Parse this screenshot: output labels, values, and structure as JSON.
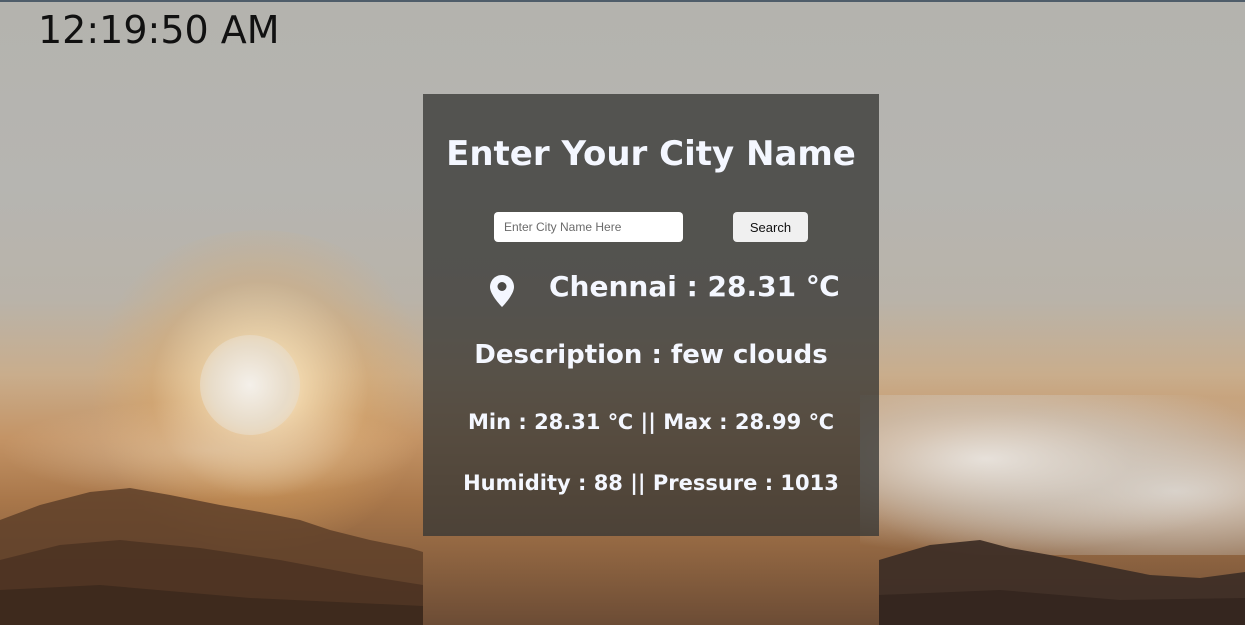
{
  "clock": {
    "time": "12:19:50 AM"
  },
  "card": {
    "title": "Enter Your City Name",
    "search": {
      "placeholder": "Enter City Name Here",
      "value": "",
      "button_label": "Search"
    },
    "location_icon": "map-pin-icon",
    "city_temp": "Chennai : 28.31 ℃",
    "description": "Description : few clouds",
    "min_max": "Min : 28.31 ℃ || Max : 28.99 ℃",
    "humidity_pressure": "Humidity : 88 || Pressure : 1013"
  },
  "colors": {
    "card_background": "#37373a",
    "text": "#f4f7ff",
    "clock_text": "#111111",
    "button_background": "#f0f0f0"
  }
}
